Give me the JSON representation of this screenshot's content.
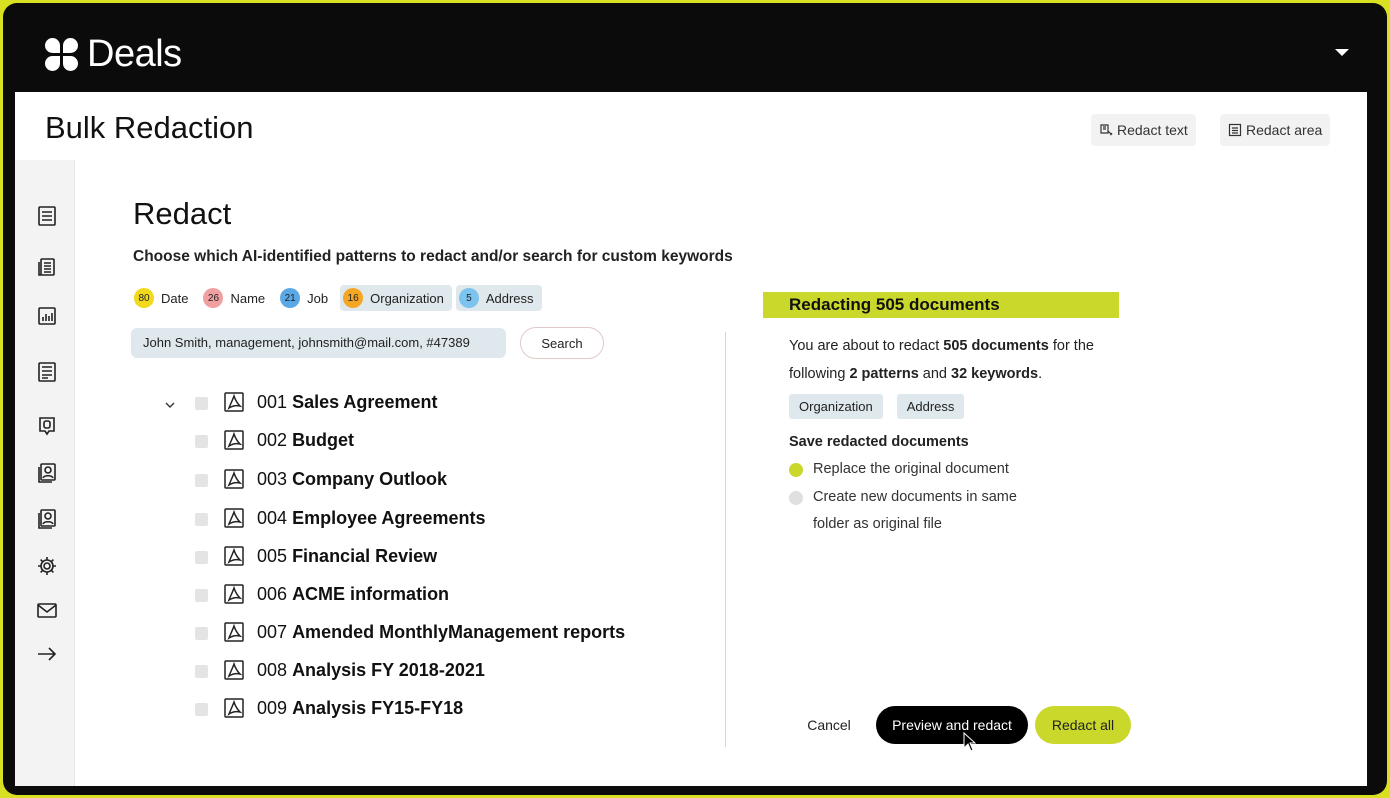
{
  "app": {
    "title": "Deals"
  },
  "page": {
    "title": "Bulk Redaction"
  },
  "toolbar": {
    "redact_text": "Redact text",
    "redact_area": "Redact area"
  },
  "sidebar": {
    "items": [
      {
        "icon": "list-icon"
      },
      {
        "icon": "clipboard-icon"
      },
      {
        "icon": "chart-icon"
      },
      {
        "icon": "document-icon"
      },
      {
        "icon": "pin-icon"
      },
      {
        "icon": "user-group-icon"
      },
      {
        "icon": "user-icon"
      },
      {
        "icon": "gear-icon"
      },
      {
        "icon": "mail-icon"
      },
      {
        "icon": "arrow-right-icon"
      }
    ]
  },
  "redact": {
    "title": "Redact",
    "subtitle": "Choose which AI-identified patterns to redact and/or search for custom keywords",
    "patterns": [
      {
        "count": "80",
        "label": "Date",
        "color": "#f2d91b",
        "selected": false
      },
      {
        "count": "26",
        "label": "Name",
        "color": "#f0a0a0",
        "selected": false
      },
      {
        "count": "21",
        "label": "Job",
        "color": "#5aa9e6",
        "selected": false
      },
      {
        "count": "16",
        "label": "Organization",
        "color": "#f5a623",
        "selected": true
      },
      {
        "count": "5",
        "label": "Address",
        "color": "#7cc3ef",
        "selected": true
      }
    ],
    "keywords_value": "John Smith, management, johnsmith@mail.com, #47389",
    "search_label": "Search"
  },
  "documents": [
    {
      "num": "001",
      "name": "Sales Agreement"
    },
    {
      "num": "002",
      "name": "Budget"
    },
    {
      "num": "003",
      "name": "Company Outlook"
    },
    {
      "num": "004",
      "name": "Employee Agreements"
    },
    {
      "num": "005",
      "name": "Financial Review"
    },
    {
      "num": "006",
      "name": "ACME information"
    },
    {
      "num": "007",
      "name": "Amended MonthlyManagement reports"
    },
    {
      "num": "008",
      "name": "Analysis FY 2018-2021"
    },
    {
      "num": "009",
      "name": "Analysis FY15-FY18"
    }
  ],
  "summary": {
    "banner": "Redacting 505 documents",
    "desc_1": "You are about to redact ",
    "desc_docs": "505 documents",
    "desc_2": " for the following ",
    "desc_patterns": "2 patterns",
    "desc_3": " and ",
    "desc_keywords": "32 keywords",
    "desc_4": ".",
    "selected_patterns": [
      "Organization",
      "Address"
    ],
    "save_title": "Save redacted documents",
    "option_replace": "Replace the original document",
    "option_new_line1": "Create new documents in same",
    "option_new_line2": "folder as original file"
  },
  "actions": {
    "cancel": "Cancel",
    "preview": "Preview and redact",
    "redact_all": "Redact all"
  }
}
